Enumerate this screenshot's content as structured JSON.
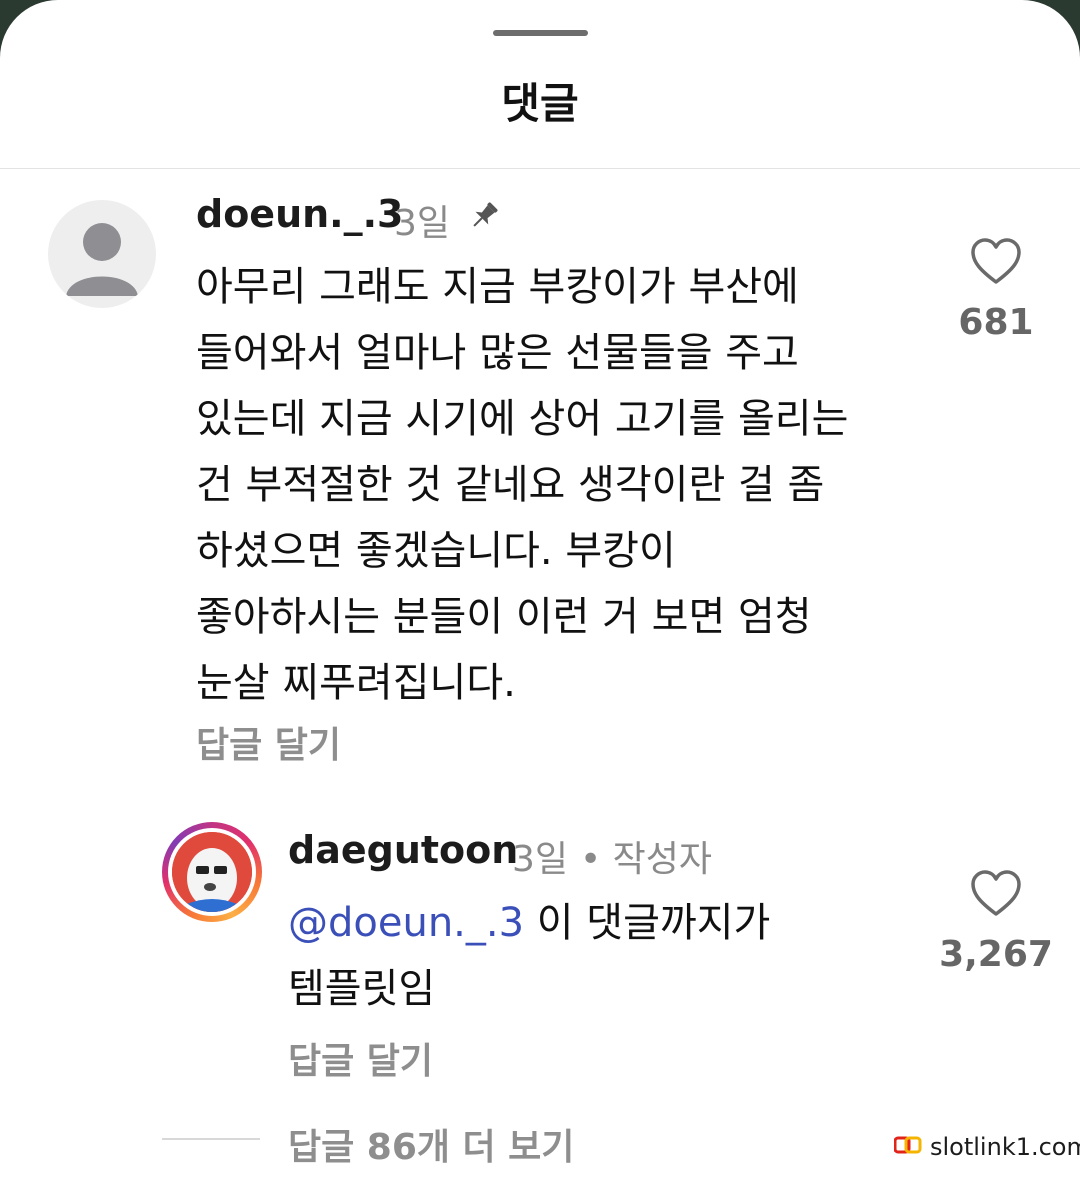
{
  "sheet": {
    "title": "댓글"
  },
  "comments": [
    {
      "username": "doeun._.3",
      "time": "3일",
      "lines": [
        "아무리 그래도 지금 부캉이가 부산에",
        "들어와서 얼마나 많은 선물들을 주고",
        "있는데 지금 시기에 상어 고기를 올리는",
        "건 부적절한 것 같네요 생각이란 걸 좀",
        "하셨으면 좋겠습니다. 부캉이",
        "좋아하시는 분들이 이런 거 보면 엄청",
        "눈살 찌푸려집니다."
      ],
      "reply_label": "답글 달기",
      "likes": "681",
      "pinned": true
    },
    {
      "username": "daegutoon",
      "time": "3일",
      "author_badge": "• 작성자",
      "mention": "@doeun._.3",
      "text_after_mention": " 이 댓글까지가",
      "line2": "템플릿임",
      "reply_label": "답글 달기",
      "likes": "3,267"
    }
  ],
  "more_replies": "답글 86개 더 보기",
  "watermark": "slotlink1.com",
  "icons": {
    "pin": "pin-icon",
    "heart": "heart-outline-icon",
    "default_avatar": "default-avatar-icon"
  }
}
